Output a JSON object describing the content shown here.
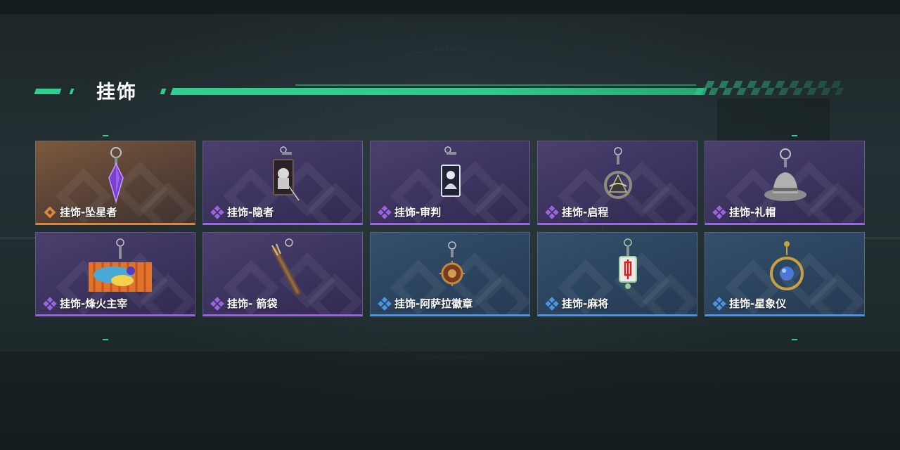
{
  "section": {
    "title": "挂饰"
  },
  "colors": {
    "accent": "#2fd08f",
    "legendary": "#d9873e",
    "epic": "#9a66e0",
    "rare": "#4c95e0"
  },
  "items": [
    {
      "label": "挂饰-坠星者",
      "rarity": "legendary",
      "icon": "crystal-pendant-icon"
    },
    {
      "label": "挂饰-隐者",
      "rarity": "epic",
      "icon": "hermit-card-icon"
    },
    {
      "label": "挂饰-审判",
      "rarity": "epic",
      "icon": "judgment-card-icon"
    },
    {
      "label": "挂饰-启程",
      "rarity": "epic",
      "icon": "journey-medallion-icon"
    },
    {
      "label": "挂饰-礼帽",
      "rarity": "epic",
      "icon": "fedora-hat-icon"
    },
    {
      "label": "挂饰-烽火主宰",
      "rarity": "epic",
      "icon": "graffiti-plate-icon"
    },
    {
      "label": "挂饰- 箭袋",
      "rarity": "epic",
      "icon": "quiver-icon"
    },
    {
      "label": "挂饰-阿萨拉徽章",
      "rarity": "rare",
      "icon": "asala-badge-icon"
    },
    {
      "label": "挂饰-麻将",
      "rarity": "rare",
      "icon": "mahjong-tile-icon"
    },
    {
      "label": "挂饰-星象仪",
      "rarity": "rare",
      "icon": "astrolabe-icon"
    }
  ]
}
